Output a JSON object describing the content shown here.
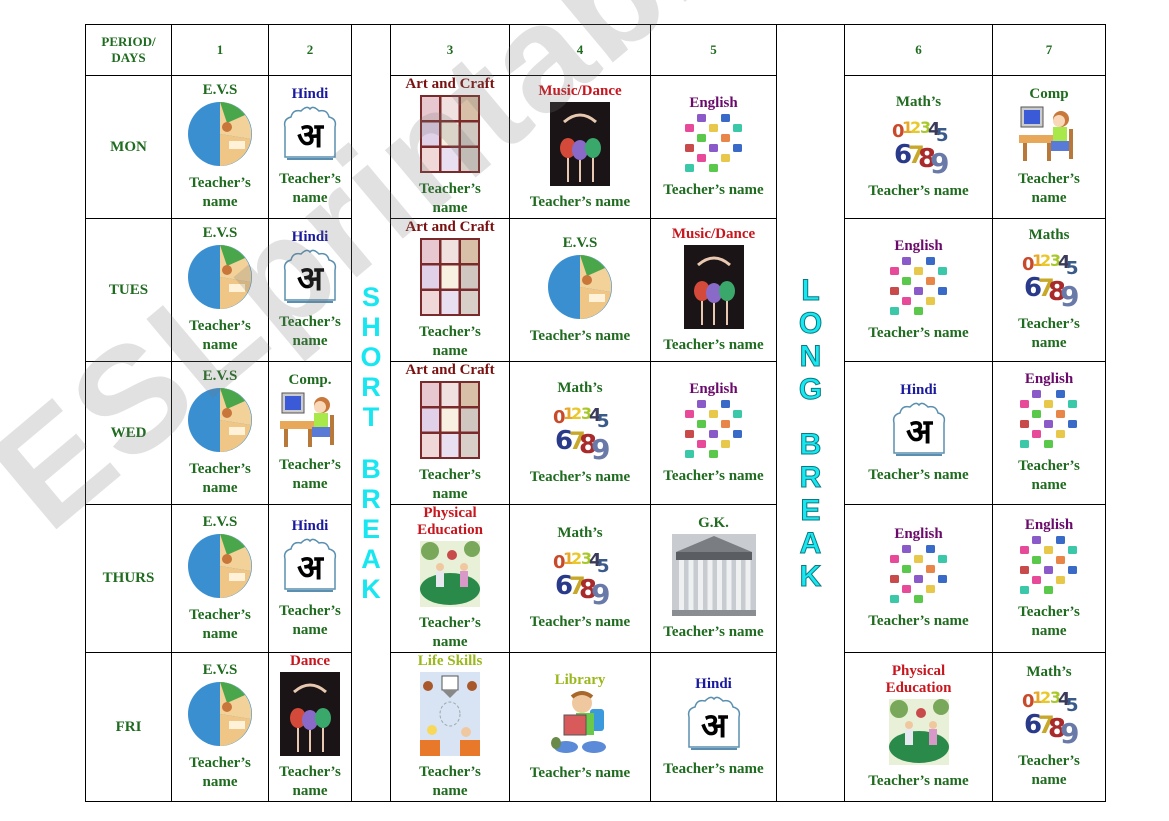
{
  "header": {
    "corner": "PERIOD/ DAYS",
    "periods": [
      "1",
      "2",
      "3",
      "4",
      "5",
      "6",
      "7"
    ]
  },
  "breaks": {
    "short": [
      "S",
      "H",
      "O",
      "R",
      "T",
      " ",
      "B",
      "R",
      "E",
      "A",
      "K"
    ],
    "long": [
      "L",
      "O",
      "N",
      "G",
      " ",
      "B",
      "R",
      "E",
      "A",
      "K"
    ],
    "short_color": "#18e6f0",
    "long_color": "#18e6f0"
  },
  "teacher_label": "Teacher’s name",
  "subject_colors": {
    "evs": "#1f6b1f",
    "hindi": "#1a1a9c",
    "art": "#7a1010",
    "music": "#c8161e",
    "english": "#6a0a6a",
    "maths": "#1f6b1f",
    "comp": "#1f6b1f",
    "pe": "#c8161e",
    "gk": "#1f6b1f",
    "life": "#9ab81c",
    "library": "#9ab81c",
    "dance": "#c8161e"
  },
  "days": [
    {
      "day": "MON",
      "cells": [
        {
          "subject": "E.V.S",
          "key": "evs"
        },
        {
          "subject": "Hindi",
          "key": "hindi"
        },
        {
          "subject": "Art and Craft",
          "key": "art"
        },
        {
          "subject": "Music/Dance",
          "key": "music"
        },
        {
          "subject": "English",
          "key": "english"
        },
        {
          "subject": "Math’s",
          "key": "maths"
        },
        {
          "subject": "Comp",
          "key": "comp"
        }
      ]
    },
    {
      "day": "TUES",
      "cells": [
        {
          "subject": "E.V.S",
          "key": "evs"
        },
        {
          "subject": "Hindi",
          "key": "hindi"
        },
        {
          "subject": "Art and Craft",
          "key": "art"
        },
        {
          "subject": "E.V.S",
          "key": "evs"
        },
        {
          "subject": "Music/Dance",
          "key": "music"
        },
        {
          "subject": "English",
          "key": "english"
        },
        {
          "subject": "Maths",
          "key": "maths"
        }
      ]
    },
    {
      "day": "WED",
      "cells": [
        {
          "subject": "E.V.S",
          "key": "evs"
        },
        {
          "subject": "Comp.",
          "key": "comp"
        },
        {
          "subject": "Art and Craft",
          "key": "art"
        },
        {
          "subject": "Math’s",
          "key": "maths"
        },
        {
          "subject": "English",
          "key": "english"
        },
        {
          "subject": "Hindi",
          "key": "hindi"
        },
        {
          "subject": "English",
          "key": "english"
        }
      ]
    },
    {
      "day": "THURS",
      "cells": [
        {
          "subject": "E.V.S",
          "key": "evs"
        },
        {
          "subject": "Hindi",
          "key": "hindi"
        },
        {
          "subject": "Physical Education",
          "key": "pe"
        },
        {
          "subject": "Math’s",
          "key": "maths"
        },
        {
          "subject": "G.K.",
          "key": "gk"
        },
        {
          "subject": "English",
          "key": "english"
        },
        {
          "subject": "English",
          "key": "english"
        }
      ]
    },
    {
      "day": "FRI",
      "cells": [
        {
          "subject": "E.V.S",
          "key": "evs"
        },
        {
          "subject": "Dance",
          "key": "dance"
        },
        {
          "subject": "Life Skills",
          "key": "life"
        },
        {
          "subject": "Library",
          "key": "library"
        },
        {
          "subject": "Hindi",
          "key": "hindi"
        },
        {
          "subject": "Physical Education",
          "key": "pe"
        },
        {
          "subject": "Math’s",
          "key": "maths"
        }
      ]
    }
  ],
  "watermark": "ESLprintables.com"
}
